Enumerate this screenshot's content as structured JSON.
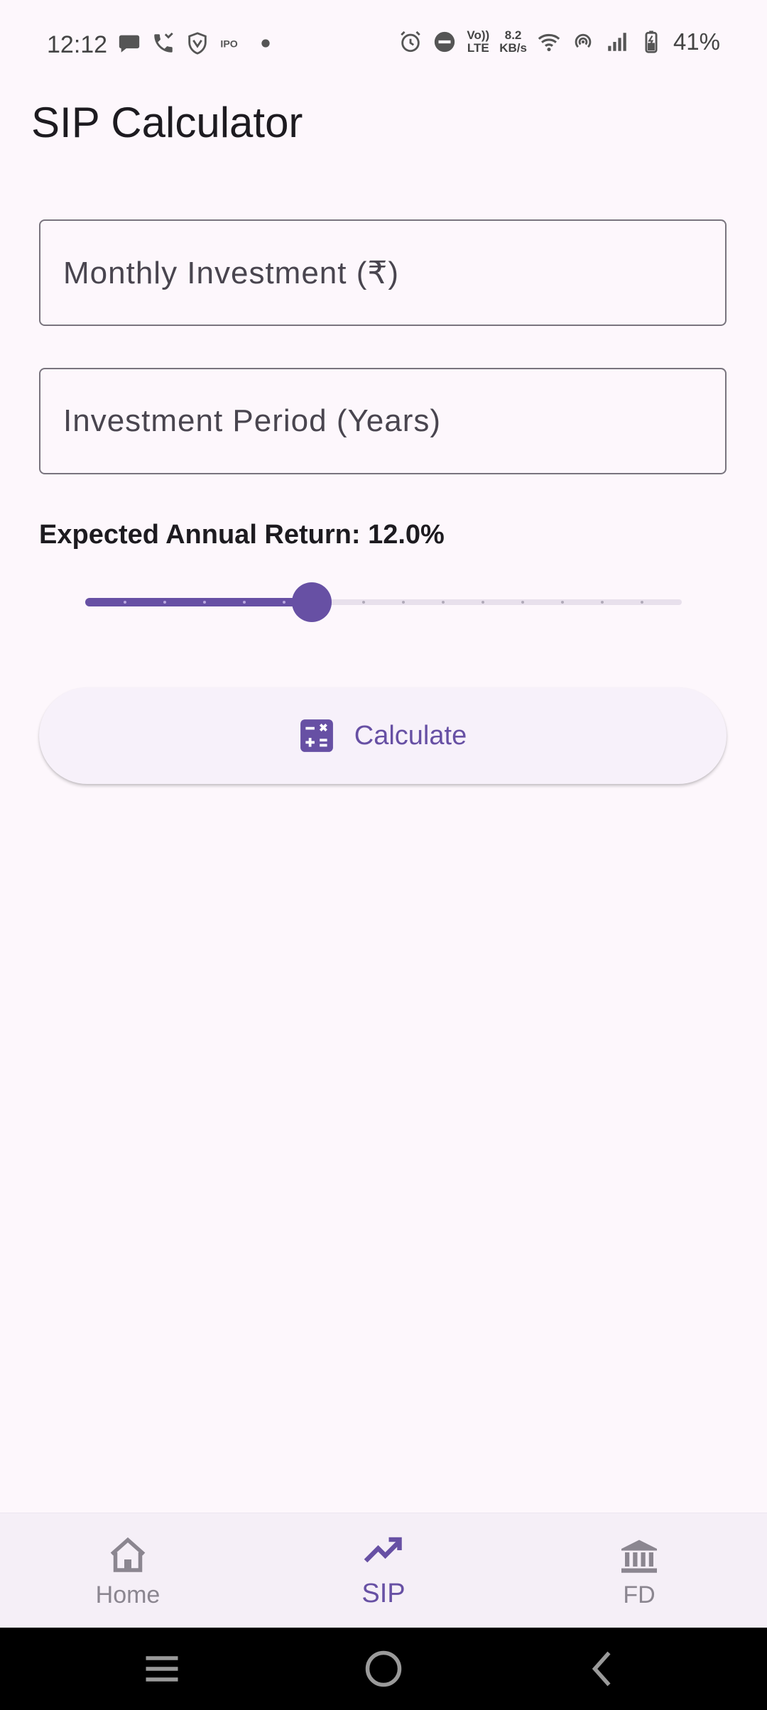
{
  "status_bar": {
    "time": "12:12",
    "net_speed_value": "8.2",
    "net_speed_unit": "KB/s",
    "volte_top": "Vo))",
    "volte_bottom": "LTE",
    "battery_percent": "41%"
  },
  "app_title": "SIP Calculator",
  "fields": {
    "monthly_investment_label": "Monthly Investment (₹)",
    "investment_period_label": "Investment Period (Years)"
  },
  "slider": {
    "label": "Expected Annual Return: 12.0%",
    "value": 12.0,
    "min": 1,
    "max": 30,
    "divisions": 15
  },
  "calculate_button": {
    "label": "Calculate",
    "icon": "calculator-icon"
  },
  "bottom_nav": {
    "items": [
      {
        "label": "Home",
        "icon": "home-icon",
        "active": false
      },
      {
        "label": "SIP",
        "icon": "trending-up-icon",
        "active": true
      },
      {
        "label": "FD",
        "icon": "bank-icon",
        "active": false
      }
    ]
  },
  "colors": {
    "primary": "#6750a4",
    "background": "#fdf7fc",
    "track_inactive": "#e8e0ec"
  }
}
